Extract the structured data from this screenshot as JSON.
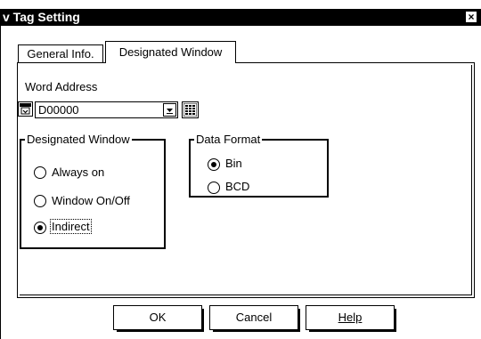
{
  "window": {
    "title": "v Tag Setting",
    "close_glyph": "×"
  },
  "tabs": [
    {
      "label": "General Info.",
      "active": false
    },
    {
      "label": "Designated Window",
      "active": true
    }
  ],
  "word_address": {
    "label": "Word Address",
    "value": "D00000"
  },
  "designated_window": {
    "label": "Designated Window",
    "options": [
      {
        "label": "Always on",
        "selected": false
      },
      {
        "label": "Window On/Off",
        "selected": false
      },
      {
        "label": "Indirect",
        "selected": true
      }
    ]
  },
  "data_format": {
    "label": "Data Format",
    "options": [
      {
        "label": "Bin",
        "selected": true
      },
      {
        "label": "BCD",
        "selected": false
      }
    ]
  },
  "buttons": {
    "ok": "OK",
    "cancel": "Cancel",
    "help": "Help"
  },
  "icons": [
    "address-input-icon",
    "dropdown-arrow-icon",
    "keypad-icon",
    "close-icon"
  ]
}
